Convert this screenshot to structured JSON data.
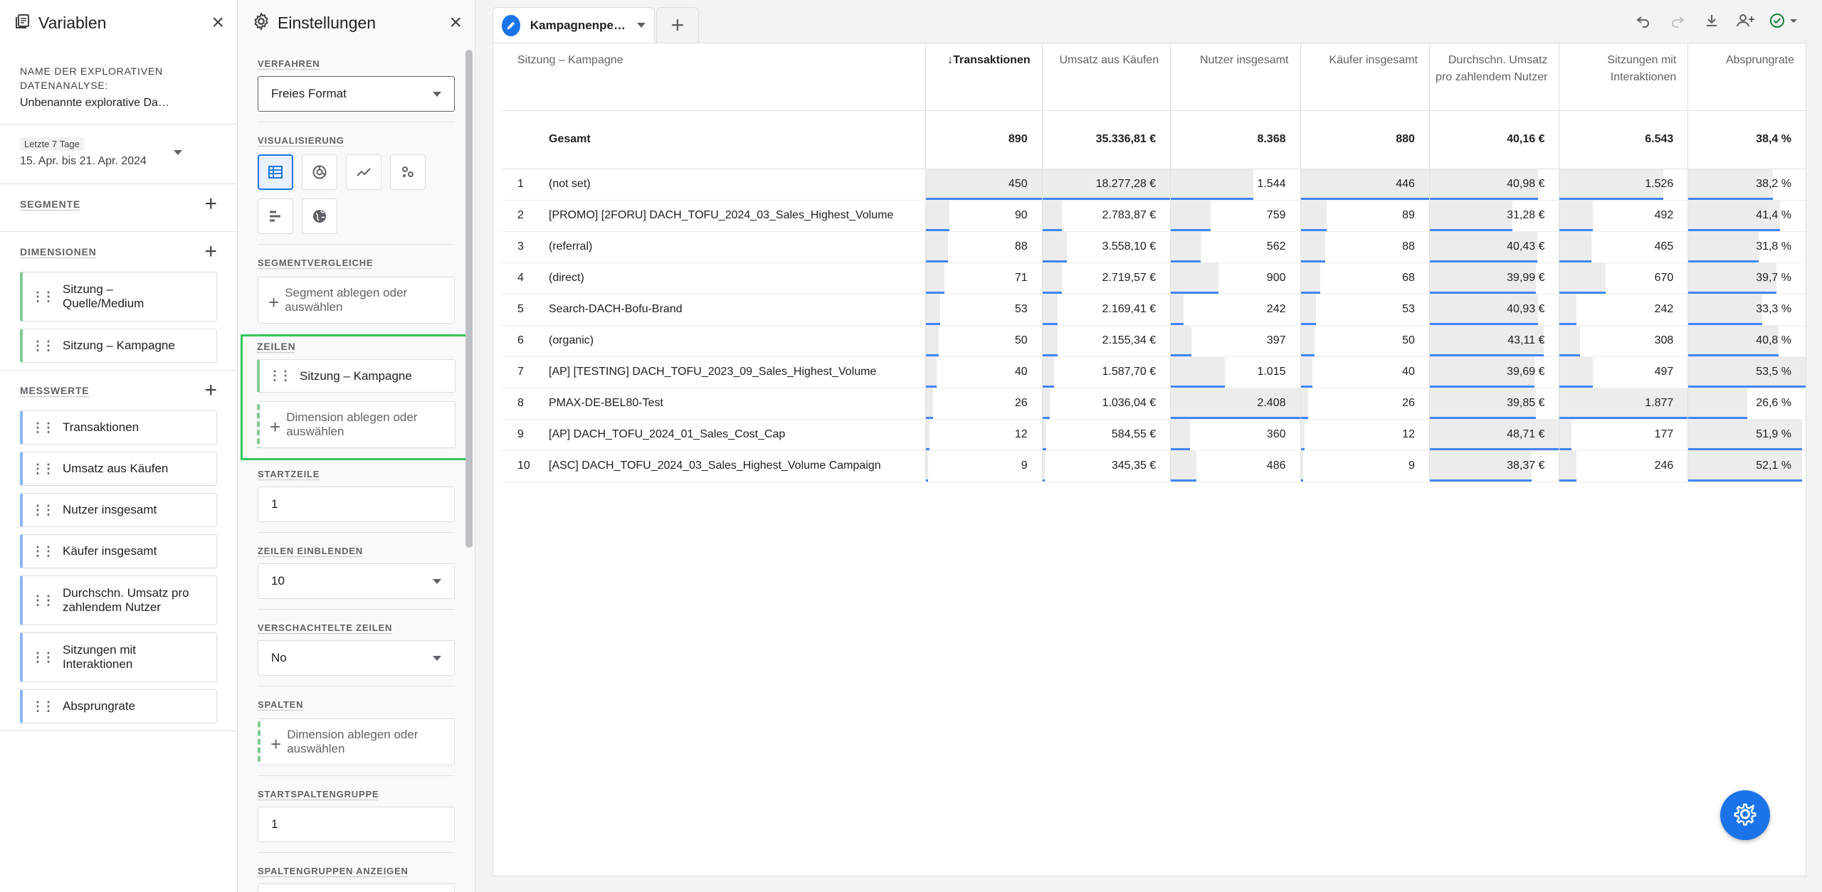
{
  "variables": {
    "title": "Variablen",
    "name_label": "NAME DER EXPLORATIVEN DATENANALYSE:",
    "name_value": "Unbenannte explorative Da…",
    "date_chip": "Letzte 7 Tage",
    "date_range": "15. Apr. bis 21. Apr. 2024",
    "segments_label": "SEGMENTE",
    "dimensions_label": "DIMENSIONEN",
    "dimensions": [
      "Sitzung – Quelle/Medium",
      "Sitzung – Kampagne"
    ],
    "metrics_label": "MESSWERTE",
    "metrics": [
      "Transaktionen",
      "Umsatz aus Käufen",
      "Nutzer insgesamt",
      "Käufer insgesamt",
      "Durchschn. Umsatz pro zahlendem Nutzer",
      "Sitzungen mit Interaktionen",
      "Absprungrate"
    ]
  },
  "settings": {
    "title": "Einstellungen",
    "technique_label": "VERFAHREN",
    "technique_value": "Freies Format",
    "viz_label": "VISUALISIERUNG",
    "segment_compare_label": "SEGMENTVERGLEICHE",
    "segment_drop": "Segment ablegen oder auswählen",
    "rows_label": "ZEILEN",
    "rows_chip": "Sitzung – Kampagne",
    "rows_drop": "Dimension ablegen oder auswählen",
    "start_row_label": "STARTZEILE",
    "start_row_value": "1",
    "show_rows_label": "ZEILEN EINBLENDEN",
    "show_rows_value": "10",
    "nested_label": "VERSCHACHTELTE ZEILEN",
    "nested_value": "No",
    "columns_label": "SPALTEN",
    "columns_drop": "Dimension ablegen oder auswählen",
    "start_col_group_label": "STARTSPALTENGRUPPE",
    "start_col_group_value": "1",
    "show_col_groups_label": "SPALTENGRUPPEN ANZEIGEN"
  },
  "canvas": {
    "tab_label": "Kampagnenpe…",
    "add_tab": "+"
  },
  "table": {
    "dim_header": "Sitzung – Kampagne",
    "sort_arrow": "↓",
    "headers": [
      "Transaktionen",
      "Umsatz aus Käufen",
      "Nutzer insgesamt",
      "Käufer insgesamt",
      "Durchschn. Umsatz pro zahlendem Nutzer",
      "Sitzungen mit Interaktionen",
      "Absprungrate"
    ],
    "total_label": "Gesamt",
    "totals": [
      "890",
      "35.336,81 €",
      "8.368",
      "880",
      "40,16 €",
      "6.543",
      "38,4 %"
    ],
    "rows": [
      {
        "idx": "1",
        "name": "(not set)",
        "cells": [
          "450",
          "18.277,28 €",
          "1.544",
          "446",
          "40,98 €",
          "1.526",
          "38,2 %"
        ],
        "fill": [
          1.0,
          1.0,
          0.64,
          1.0,
          0.84,
          0.81,
          0.72
        ]
      },
      {
        "idx": "2",
        "name": "[PROMO] [2FORU] DACH_TOFU_2024_03_Sales_Highest_Volume",
        "cells": [
          "90",
          "2.783,87 €",
          "759",
          "89",
          "31,28 €",
          "492",
          "41,4 %"
        ],
        "fill": [
          0.2,
          0.15,
          0.31,
          0.2,
          0.64,
          0.26,
          0.78
        ]
      },
      {
        "idx": "3",
        "name": "(referral)",
        "cells": [
          "88",
          "3.558,10 €",
          "562",
          "88",
          "40,43 €",
          "465",
          "31,8 %"
        ],
        "fill": [
          0.19,
          0.19,
          0.23,
          0.19,
          0.83,
          0.25,
          0.6
        ]
      },
      {
        "idx": "4",
        "name": "(direct)",
        "cells": [
          "71",
          "2.719,57 €",
          "900",
          "68",
          "39,99 €",
          "670",
          "39,7 %"
        ],
        "fill": [
          0.16,
          0.15,
          0.37,
          0.15,
          0.82,
          0.36,
          0.75
        ]
      },
      {
        "idx": "5",
        "name": "Search-DACH-Bofu-Brand",
        "cells": [
          "53",
          "2.169,41 €",
          "242",
          "53",
          "40,93 €",
          "242",
          "33,3 %"
        ],
        "fill": [
          0.12,
          0.12,
          0.1,
          0.12,
          0.84,
          0.13,
          0.63
        ]
      },
      {
        "idx": "6",
        "name": "(organic)",
        "cells": [
          "50",
          "2.155,34 €",
          "397",
          "50",
          "43,11 €",
          "308",
          "40,8 %"
        ],
        "fill": [
          0.11,
          0.12,
          0.16,
          0.11,
          0.88,
          0.16,
          0.77
        ]
      },
      {
        "idx": "7",
        "name": "[AP] [TESTING] DACH_TOFU_2023_09_Sales_Highest_Volume",
        "cells": [
          "40",
          "1.587,70 €",
          "1.015",
          "40",
          "39,69 €",
          "497",
          "53,5 %"
        ],
        "fill": [
          0.09,
          0.09,
          0.42,
          0.09,
          0.81,
          0.26,
          1.0
        ]
      },
      {
        "idx": "8",
        "name": "PMAX-DE-BEL80-Test",
        "cells": [
          "26",
          "1.036,04 €",
          "2.408",
          "26",
          "39,85 €",
          "1.877",
          "26,6 %"
        ],
        "fill": [
          0.06,
          0.06,
          1.0,
          0.06,
          0.82,
          1.0,
          0.5
        ]
      },
      {
        "idx": "9",
        "name": "[AP] DACH_TOFU_2024_01_Sales_Cost_Cap",
        "cells": [
          "12",
          "584,55 €",
          "360",
          "12",
          "48,71 €",
          "177",
          "51,9 %"
        ],
        "fill": [
          0.03,
          0.03,
          0.15,
          0.03,
          1.0,
          0.09,
          0.97
        ]
      },
      {
        "idx": "10",
        "name": "[ASC] DACH_TOFU_2024_03_Sales_Highest_Volume Campaign",
        "cells": [
          "9",
          "345,35 €",
          "486",
          "9",
          "38,37 €",
          "246",
          "52,1 %"
        ],
        "fill": [
          0.02,
          0.02,
          0.2,
          0.02,
          0.79,
          0.13,
          0.97
        ]
      }
    ]
  },
  "colors": {
    "accent": "#1a73e8",
    "bar_line": "#4285f4",
    "dimension_chip": "#81c995",
    "metric_chip": "#8ab4f8",
    "highlight": "#34c759"
  }
}
